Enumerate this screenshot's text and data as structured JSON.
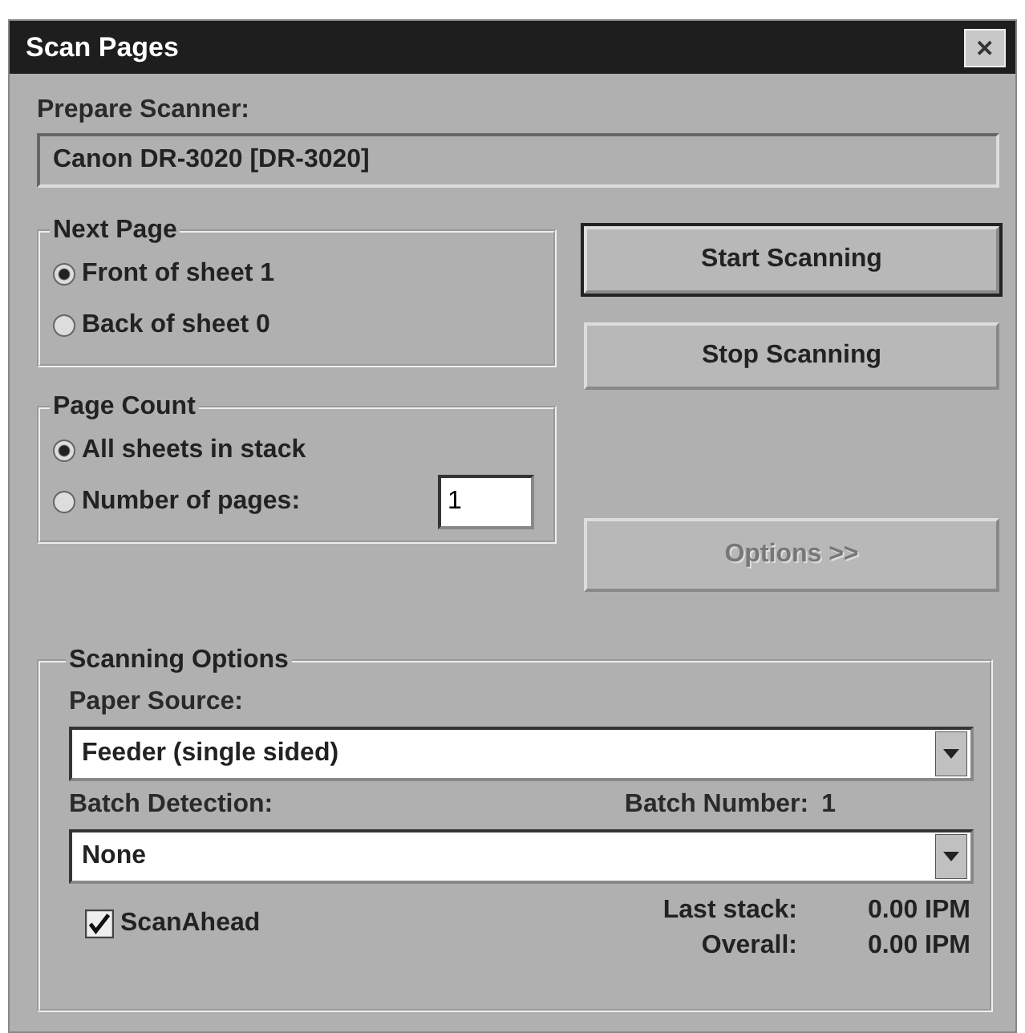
{
  "window": {
    "title": "Scan Pages",
    "close": "✕"
  },
  "scanner": {
    "label": "Prepare Scanner:",
    "value": "Canon DR-3020 [DR-3020]"
  },
  "next_page": {
    "title": "Next Page",
    "options": [
      {
        "label": "Front of sheet 1",
        "selected": true
      },
      {
        "label": "Back of sheet 0",
        "selected": false
      }
    ]
  },
  "page_count": {
    "title": "Page Count",
    "options": [
      {
        "label": "All sheets in stack",
        "selected": true
      },
      {
        "label": "Number of pages:",
        "selected": false
      }
    ],
    "pages_value": "1"
  },
  "buttons": [
    {
      "label": "Start Scanning",
      "disabled": false,
      "default": true
    },
    {
      "label": "Stop Scanning",
      "disabled": false,
      "default": false
    },
    {
      "label": "Options >>",
      "disabled": true,
      "default": false
    }
  ],
  "scanning_options": {
    "title": "Scanning Options",
    "paper_source": {
      "label": "Paper Source:",
      "value": "Feeder (single sided)"
    },
    "batch_detection": {
      "label": "Batch Detection:",
      "value": "None"
    },
    "batch_number": {
      "label": "Batch Number:",
      "value": "1"
    },
    "scan_ahead": {
      "label": "ScanAhead",
      "checked": true
    },
    "stats": [
      {
        "label": "Last stack:",
        "value": "0.00 IPM"
      },
      {
        "label": "Overall:",
        "value": "0.00 IPM"
      }
    ]
  }
}
